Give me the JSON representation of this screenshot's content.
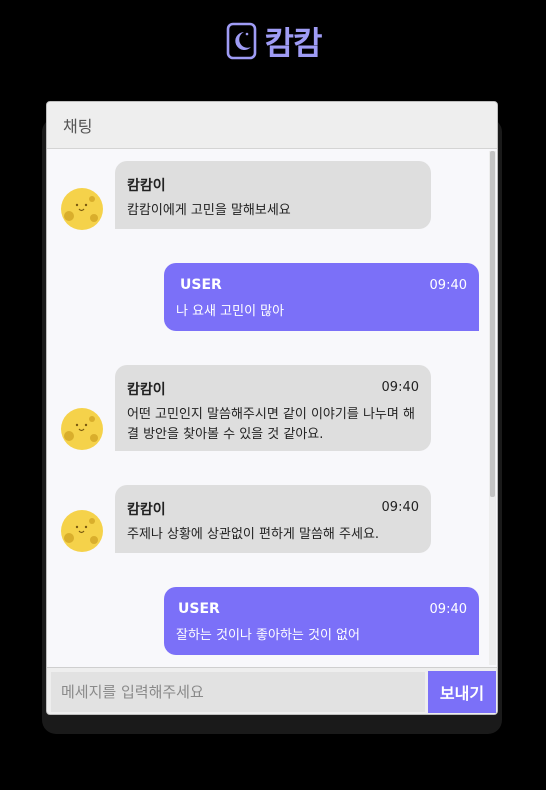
{
  "brand": {
    "name": "캄캄",
    "icon": "moon-card-icon",
    "color": "#9f9cf5"
  },
  "chat": {
    "title": "채팅",
    "messages": [
      {
        "sender": "캄캄이",
        "time": "",
        "text": "캄캄이에게 고민을 말해보세요",
        "from": "bot"
      },
      {
        "sender": "USER",
        "time": "09:40",
        "text": "나 요새 고민이 많아",
        "from": "user"
      },
      {
        "sender": "캄캄이",
        "time": "09:40",
        "text": "어떤 고민인지 말씀해주시면 같이 이야기를 나누며 해결 방안을 찾아볼 수 있을 것 같아요.",
        "from": "bot"
      },
      {
        "sender": "캄캄이",
        "time": "09:40",
        "text": "주제나 상황에 상관없이 편하게 말씀해 주세요.",
        "from": "bot"
      },
      {
        "sender": "USER",
        "time": "09:40",
        "text": "잘하는 것이나 좋아하는 것이 없어",
        "from": "user"
      }
    ]
  },
  "input": {
    "placeholder": "메세지를 입력해주세요",
    "value": ""
  },
  "send_label": "보내기",
  "colors": {
    "accent": "#7b70f8",
    "bot_bubble": "#dedede",
    "avatar": "#f5d24a"
  }
}
